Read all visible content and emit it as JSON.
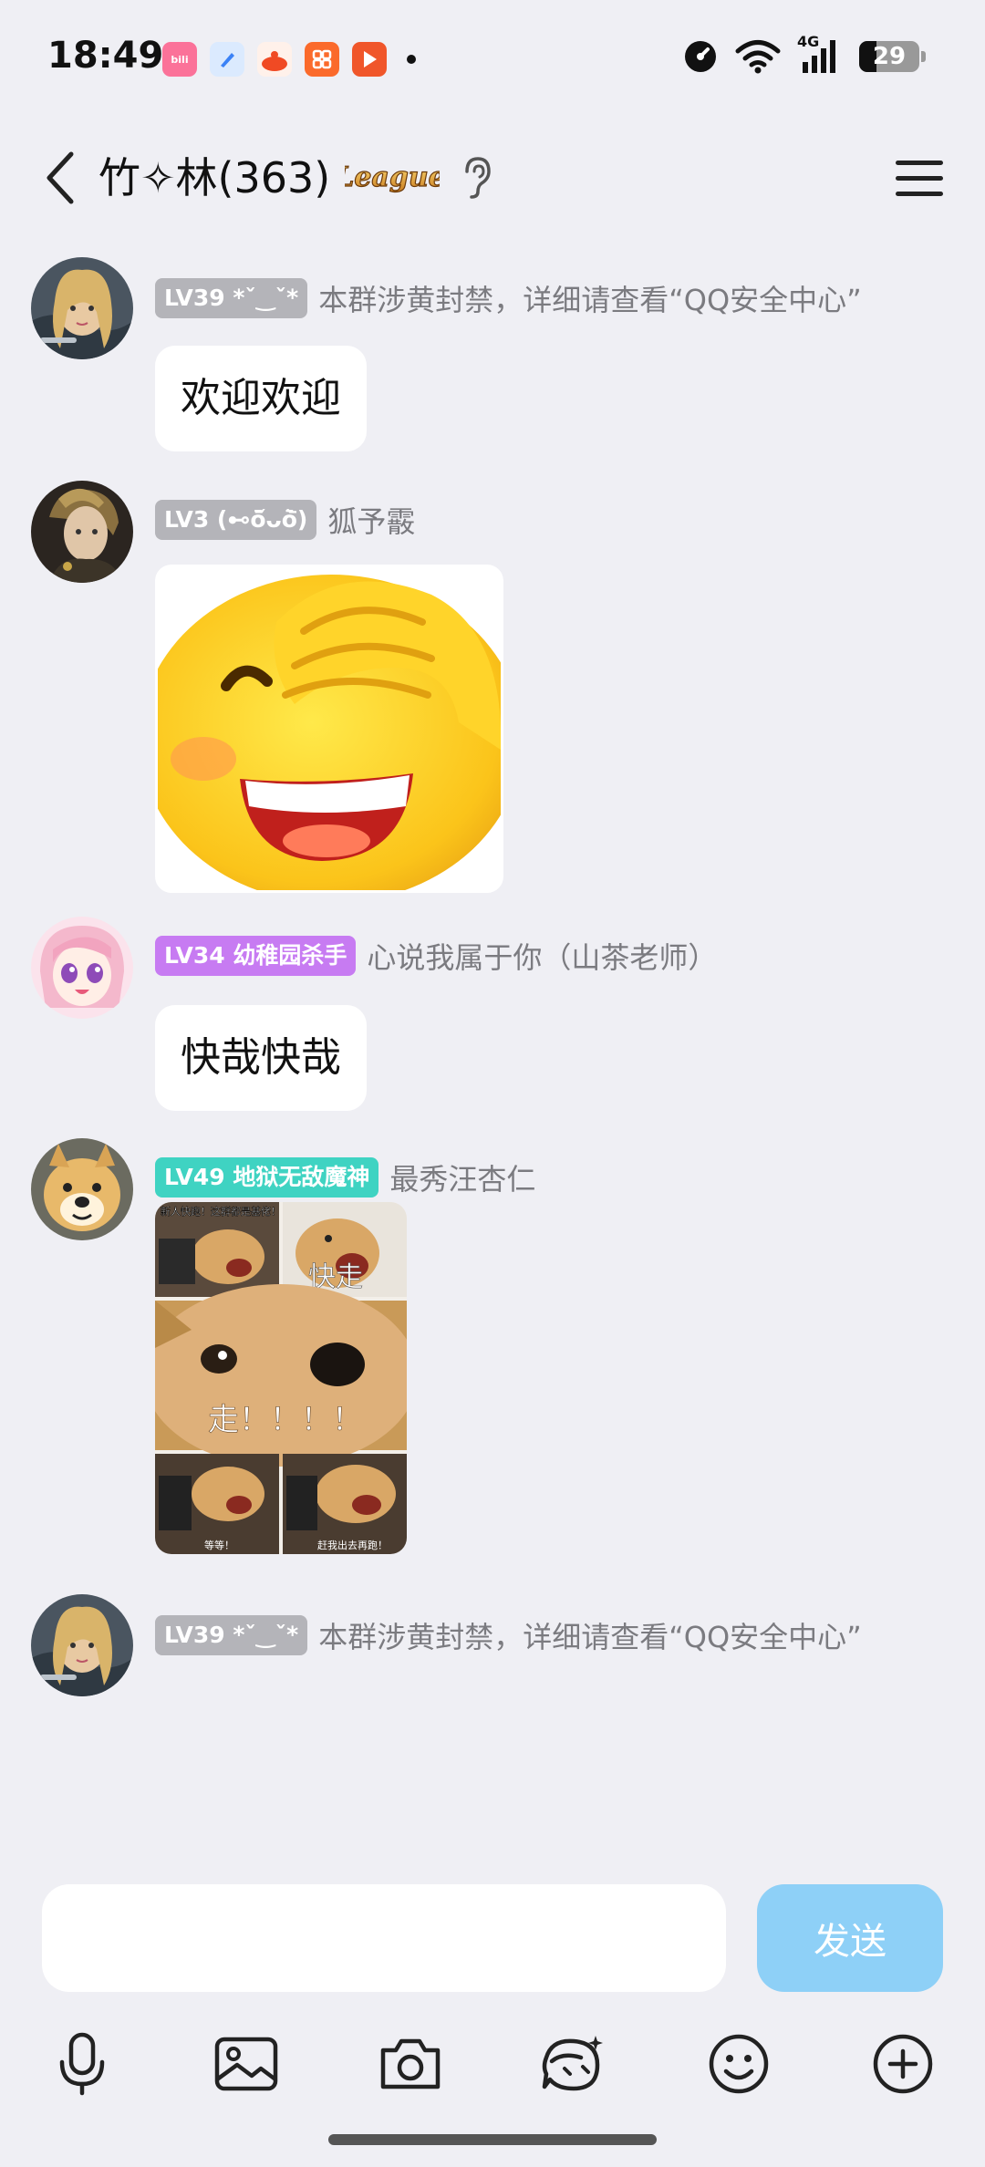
{
  "status_bar": {
    "time": "18:49",
    "network": "4G",
    "battery": "29",
    "battery_level": 0.29,
    "app_icons": [
      {
        "name": "bilibili-icon",
        "label": "bili",
        "color": "#fb7299"
      },
      {
        "name": "app-blue-icon",
        "label": "",
        "color": "#3b82f6"
      },
      {
        "name": "app-orange-icon",
        "label": "",
        "color": "#f04a24"
      },
      {
        "name": "app-grid-icon",
        "label": "",
        "color": "#fb6a2b"
      },
      {
        "name": "video-play-icon",
        "label": "",
        "color": "#f0562a"
      }
    ]
  },
  "header": {
    "title": "竹✧林(363)",
    "badge_text": "League"
  },
  "messages": [
    {
      "level": "LV39 *ˇ‿ˇ*",
      "level_color": "#b4b4b9",
      "nick": "本群涉黄封禁，详细请查看“QQ安全中心”",
      "text": "欢迎欢迎"
    },
    {
      "level": "LV3 (⊷ō᷄ᴗō᷅)",
      "level_color": "#b4b4b9",
      "nick": "狐予霰"
    },
    {
      "level": "LV34 幼稚园杀手",
      "level_color": "#c77bf2",
      "nick": "心说我属于你（山茶老师）",
      "text": "快哉快哉"
    },
    {
      "level": "LV49 地狱无敌魔神",
      "level_color": "#3fd3c2",
      "nick": "最秀汪杏仁",
      "meme": {
        "top_left": "新人快跑！这群都是基佬！",
        "top_right": "快走",
        "middle": "走！！！！",
        "bottom_left": "等等！",
        "bottom_right": "赶我出去再跑！"
      }
    },
    {
      "level": "LV39 *ˇ‿ˇ*",
      "level_color": "#b4b4b9",
      "nick": "本群涉黄封禁，详细请查看“QQ安全中心”"
    }
  ],
  "input": {
    "placeholder": "",
    "send_label": "发送",
    "send_color": "#8ed0f7"
  }
}
